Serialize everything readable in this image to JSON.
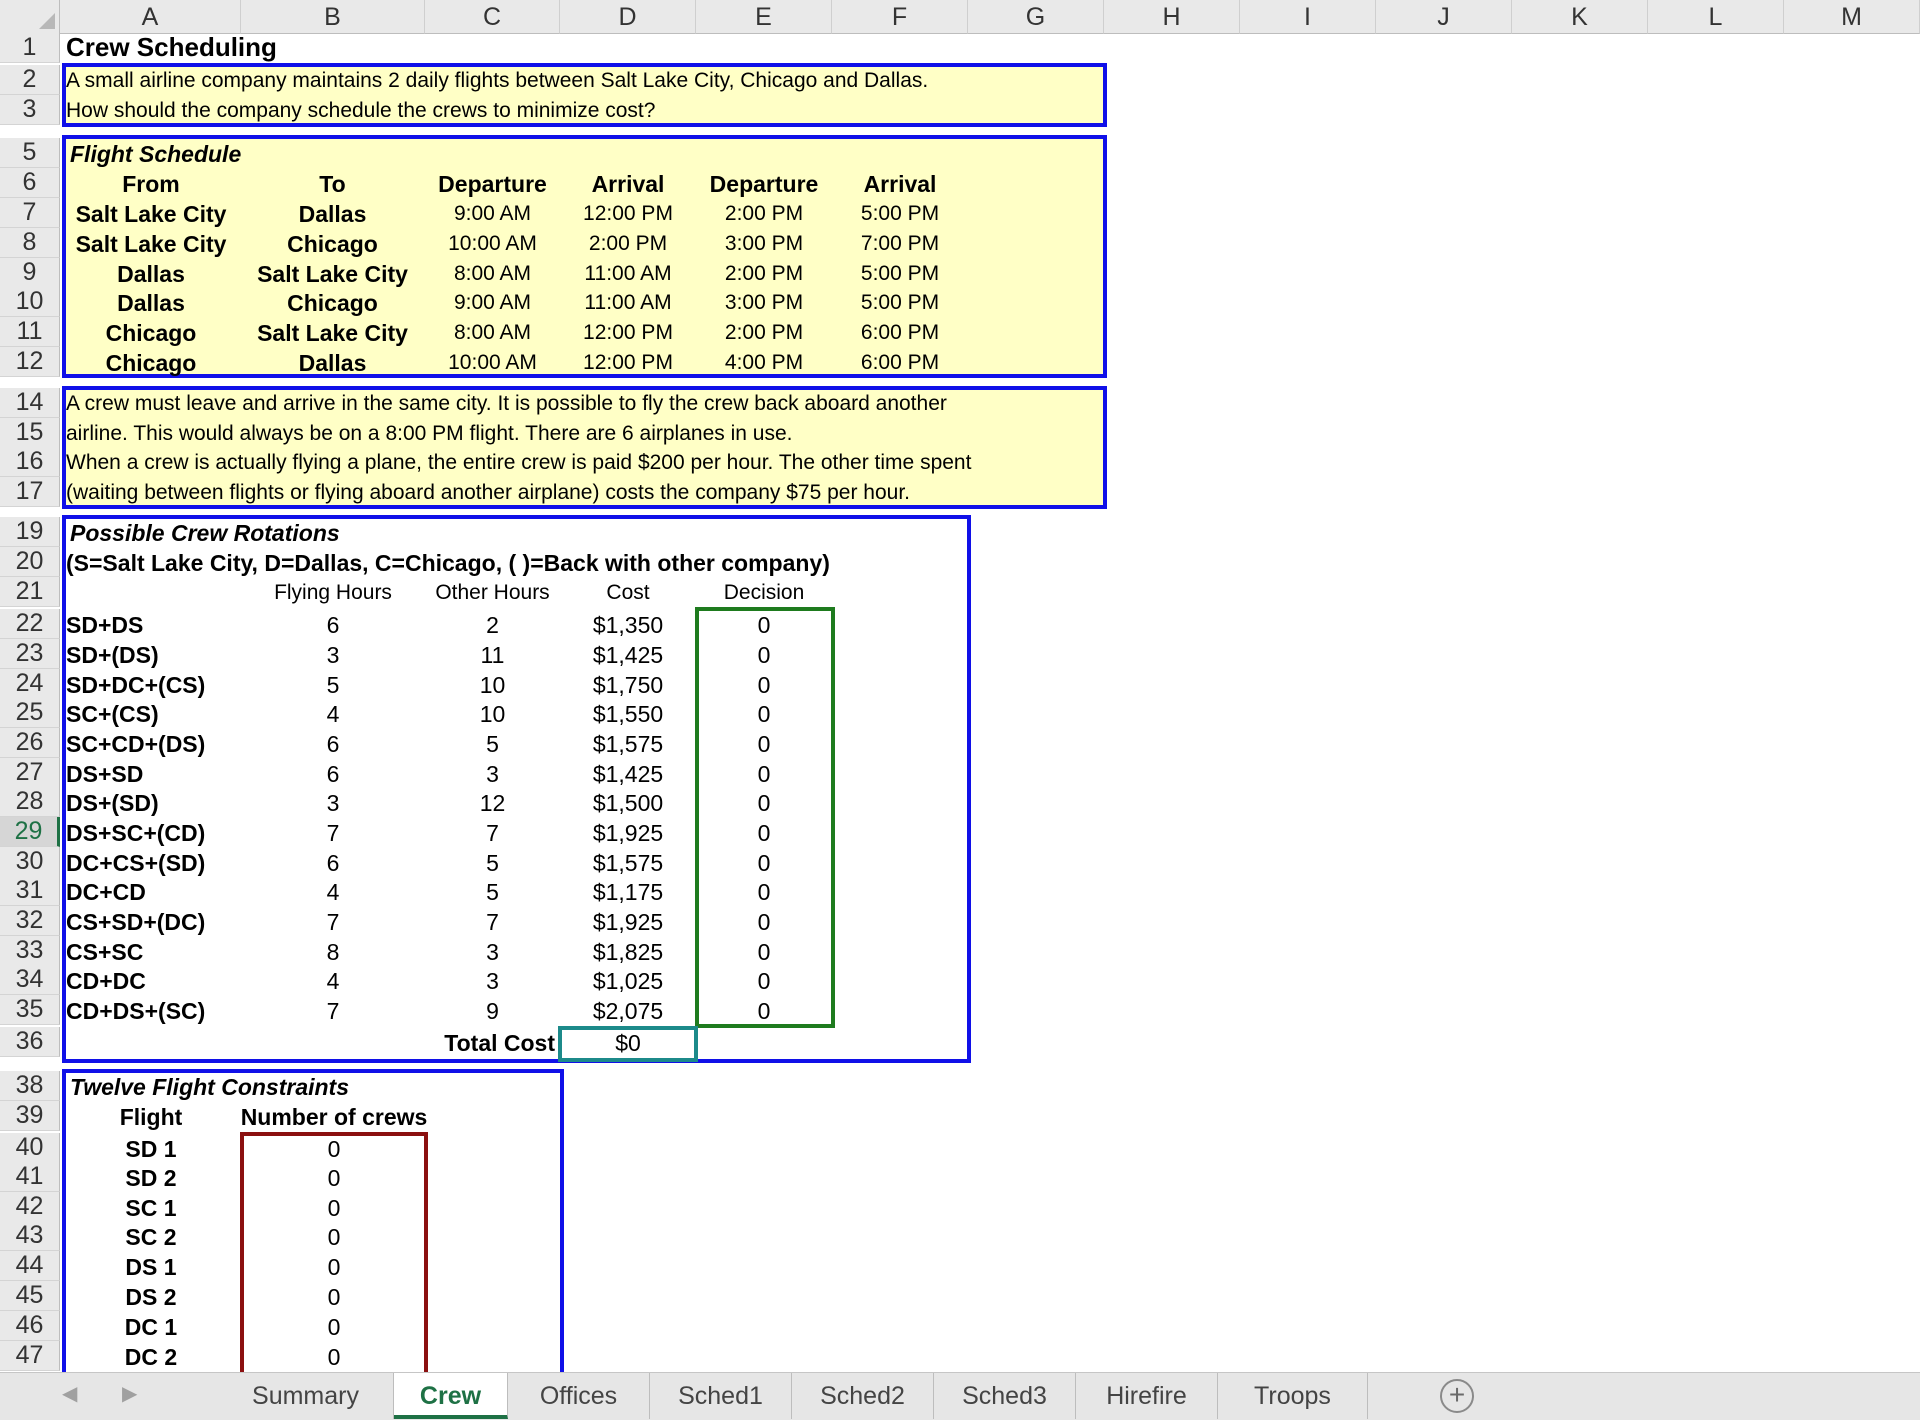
{
  "columns": [
    "A",
    "B",
    "C",
    "D",
    "E",
    "F",
    "G",
    "H",
    "I",
    "J",
    "K",
    "L",
    "M"
  ],
  "rows": [
    "1",
    "2",
    "3",
    "5",
    "6",
    "7",
    "8",
    "9",
    "10",
    "11",
    "12",
    "14",
    "15",
    "16",
    "17",
    "19",
    "20",
    "21",
    "22",
    "23",
    "24",
    "25",
    "26",
    "27",
    "28",
    "29",
    "30",
    "31",
    "32",
    "33",
    "34",
    "35",
    "36",
    "38",
    "39",
    "40",
    "41",
    "42",
    "43",
    "44",
    "45",
    "46",
    "47"
  ],
  "selected_row": "29",
  "title": "Crew Scheduling",
  "intro": [
    "A small airline company maintains 2 daily flights between Salt Lake City, Chicago and Dallas.",
    "How should the company schedule the crews to minimize cost?"
  ],
  "flight_schedule": {
    "title": "Flight Schedule",
    "headers": [
      "From",
      "To",
      "Departure",
      "Arrival",
      "Departure",
      "Arrival"
    ],
    "rows": [
      [
        "Salt Lake City",
        "Dallas",
        "9:00 AM",
        "12:00 PM",
        "2:00 PM",
        "5:00 PM"
      ],
      [
        "Salt Lake City",
        "Chicago",
        "10:00 AM",
        "2:00 PM",
        "3:00 PM",
        "7:00 PM"
      ],
      [
        "Dallas",
        "Salt Lake City",
        "8:00 AM",
        "11:00 AM",
        "2:00 PM",
        "5:00 PM"
      ],
      [
        "Dallas",
        "Chicago",
        "9:00 AM",
        "11:00 AM",
        "3:00 PM",
        "5:00 PM"
      ],
      [
        "Chicago",
        "Salt Lake City",
        "8:00 AM",
        "12:00 PM",
        "2:00 PM",
        "6:00 PM"
      ],
      [
        "Chicago",
        "Dallas",
        "10:00 AM",
        "12:00 PM",
        "4:00 PM",
        "6:00 PM"
      ]
    ]
  },
  "rules": [
    "A crew must leave and arrive in the same city. It is possible to fly the crew back aboard another",
    "airline. This would always be on a 8:00 PM flight. There are 6 airplanes in use.",
    "When a crew is actually flying a plane, the entire crew is paid $200 per hour. The other time spent",
    "(waiting between flights or flying aboard another airplane) costs the company $75 per hour."
  ],
  "rotations": {
    "title": "Possible Crew Rotations",
    "legend": "(S=Salt Lake City, D=Dallas, C=Chicago, ( )=Back with other company)",
    "headers": [
      "Flying Hours",
      "Other Hours",
      "Cost",
      "Decision"
    ],
    "rows": [
      [
        "SD+DS",
        "6",
        "2",
        "$1,350",
        "0"
      ],
      [
        "SD+(DS)",
        "3",
        "11",
        "$1,425",
        "0"
      ],
      [
        "SD+DC+(CS)",
        "5",
        "10",
        "$1,750",
        "0"
      ],
      [
        "SC+(CS)",
        "4",
        "10",
        "$1,550",
        "0"
      ],
      [
        "SC+CD+(DS)",
        "6",
        "5",
        "$1,575",
        "0"
      ],
      [
        "DS+SD",
        "6",
        "3",
        "$1,425",
        "0"
      ],
      [
        "DS+(SD)",
        "3",
        "12",
        "$1,500",
        "0"
      ],
      [
        "DS+SC+(CD)",
        "7",
        "7",
        "$1,925",
        "0"
      ],
      [
        "DC+CS+(SD)",
        "6",
        "5",
        "$1,575",
        "0"
      ],
      [
        "DC+CD",
        "4",
        "5",
        "$1,175",
        "0"
      ],
      [
        "CS+SD+(DC)",
        "7",
        "7",
        "$1,925",
        "0"
      ],
      [
        "CS+SC",
        "8",
        "3",
        "$1,825",
        "0"
      ],
      [
        "CD+DC",
        "4",
        "3",
        "$1,025",
        "0"
      ],
      [
        "CD+DS+(SC)",
        "7",
        "9",
        "$2,075",
        "0"
      ]
    ],
    "total_label": "Total Cost",
    "total_value": "$0"
  },
  "constraints": {
    "title": "Twelve Flight Constraints",
    "headers": [
      "Flight",
      "Number of crews"
    ],
    "rows": [
      [
        "SD 1",
        "0"
      ],
      [
        "SD 2",
        "0"
      ],
      [
        "SC 1",
        "0"
      ],
      [
        "SC 2",
        "0"
      ],
      [
        "DS 1",
        "0"
      ],
      [
        "DS 2",
        "0"
      ],
      [
        "DC 1",
        "0"
      ],
      [
        "DC 2",
        "0"
      ]
    ]
  },
  "tabs": [
    "Summary",
    "Crew",
    "Offices",
    "Sched1",
    "Sched2",
    "Sched3",
    "Hirefire",
    "Troops"
  ],
  "active_tab": "Crew",
  "colors": {
    "blue_border": "#1010e8",
    "green_border": "#1e7b1e",
    "teal_border": "#1c8a8a",
    "red_border": "#8b1010",
    "fill": "#ffffc6",
    "excel_green": "#1e7145"
  }
}
